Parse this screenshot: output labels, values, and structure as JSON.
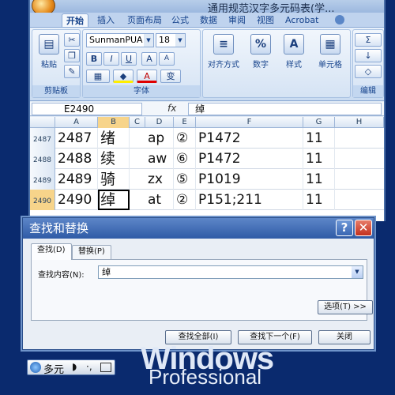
{
  "excel": {
    "title": "通用规范汉字多元码表(学...",
    "tabs": [
      "开始",
      "插入",
      "页面布局",
      "公式",
      "数据",
      "审阅",
      "视图",
      "Acrobat"
    ],
    "ribbon": {
      "paste_label": "粘贴",
      "clipboard_label": "剪贴板",
      "font_name": "SunmanPUA",
      "font_size": "18",
      "font_label": "字体",
      "bold": "B",
      "italic": "I",
      "underline": "U",
      "grow_font": "A",
      "shrink_font": "A",
      "phonetic": "变",
      "font_color": "A",
      "align_label": "对齐方式",
      "number_label": "数字",
      "number_icon": "%",
      "styles_label": "样式",
      "cells_label": "单元格",
      "edit_label": "编辑",
      "sum_icon": "Σ"
    },
    "name_box": "E2490",
    "fx_label": "fx",
    "formula": "绰",
    "columns": [
      "A",
      "B",
      "C",
      "D",
      "E",
      "F",
      "G",
      "H"
    ],
    "rows": [
      {
        "num": "2487",
        "a": "2487",
        "b": "绪",
        "d": "ap",
        "e": "②",
        "f": "P1472",
        "g": "11"
      },
      {
        "num": "2488",
        "a": "2488",
        "b": "续",
        "d": "aw",
        "e": "⑥",
        "f": "P1472",
        "g": "11"
      },
      {
        "num": "2489",
        "a": "2489",
        "b": "骑",
        "d": "zx",
        "e": "⑤",
        "f": "P1019",
        "g": "11"
      },
      {
        "num": "2490",
        "a": "2490",
        "b": "绰",
        "d": "at",
        "e": "②",
        "f": "P151;211",
        "g": "11"
      }
    ]
  },
  "dialog": {
    "title": "查找和替换",
    "help": "?",
    "close": "✕",
    "tab_find": "查找(D)",
    "tab_replace": "替换(P)",
    "find_label": "查找内容(N):",
    "find_value": "绰",
    "options": "选项(T) >>",
    "find_all": "查找全部(I)",
    "find_next": "查找下一个(F)",
    "close_btn": "关闭"
  },
  "taskbar": {
    "lang": "多元"
  },
  "desktop": {
    "windows": "Windows",
    "edition": "Professional"
  }
}
